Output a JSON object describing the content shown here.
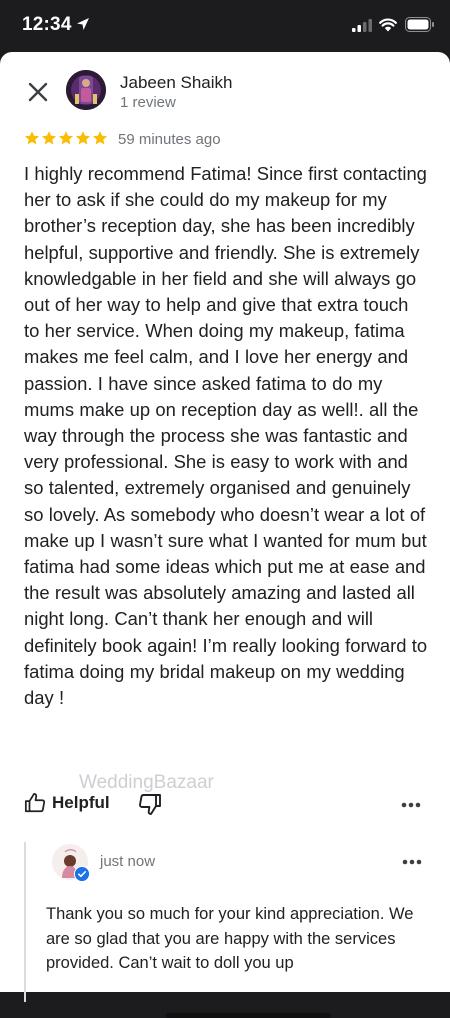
{
  "status_bar": {
    "time": "12:34"
  },
  "reviewer": {
    "name": "Jabeen Shaikh",
    "review_count": "1 review"
  },
  "rating": {
    "stars": 5,
    "max": 5,
    "color": "#fbbc04",
    "time": "59 minutes ago"
  },
  "review": {
    "text": "I highly recommend Fatima! Since first contacting her to ask if she could do my makeup for my brother’s reception day, she has been incredibly helpful, supportive and friendly. She is extremely knowledgable in her field and she will always go out of her way to help and give that extra touch to her service. When doing my makeup, fatima makes me feel calm, and I love her energy and passion. I have since asked fatima to do my mums make up on reception day as well!. all the way through the process she was fantastic and very professional. She is easy to work with and so talented, extremely organised and genuinely so lovely. As somebody who doesn’t wear a lot of make up I wasn’t sure what I wanted for mum but fatima had some ideas which put me at ease and the result was absolutely amazing and lasted all night long. Can’t thank her enough and will definitely book again! I’m really looking forward to fatima doing my bridal makeup on my wedding day !"
  },
  "watermark": "WeddingBazaar",
  "actions": {
    "helpful_label": "Helpful"
  },
  "owner_reply": {
    "time": "just now",
    "text": "Thank you so much for your kind appreciation. We are so glad that you are happy with the services provided. Can’t wait to doll you up"
  },
  "icons": {
    "close": "close-icon",
    "thumbs_up": "thumbs-up-icon",
    "thumbs_down": "thumbs-down-icon",
    "more": "more-horizontal-icon",
    "verified": "verified-check-icon"
  },
  "colors": {
    "star": "#fbbc04",
    "verified": "#1a73e8",
    "secondary_text": "#70757a"
  }
}
